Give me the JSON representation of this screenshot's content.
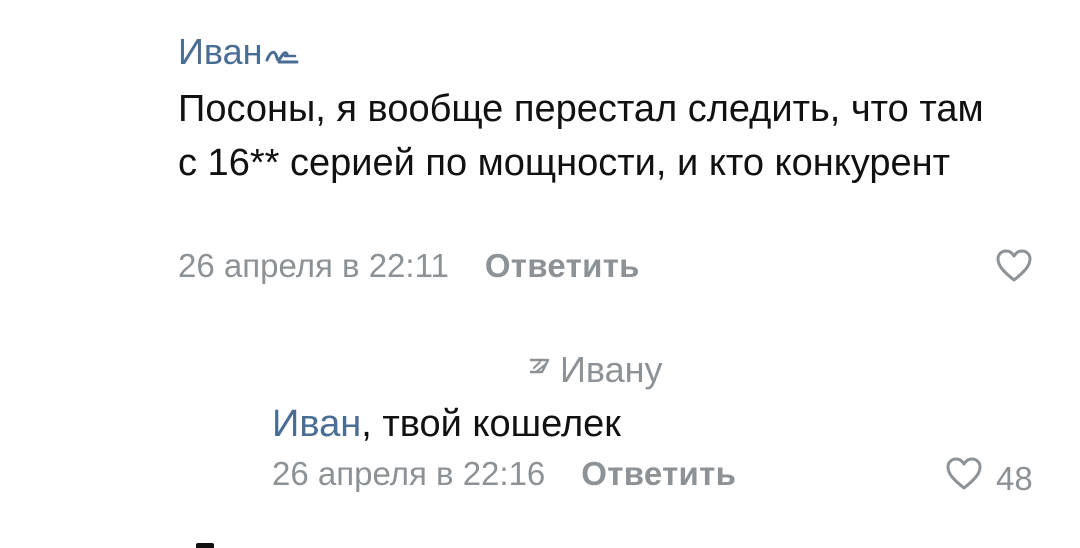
{
  "comment": {
    "author": "Иван",
    "text": "Посоны, я вообще перестал следить, что там с 16** серией по мощности, и кто конкурент",
    "timestamp": "26 апреля в 22:11",
    "reply_label": "Ответить",
    "icons": {
      "like": "heart-outline-icon",
      "author_mark": "scribble-mark-icon"
    }
  },
  "reply": {
    "reply_to": "Ивану",
    "mention": "Иван",
    "text": ", твой кошелек",
    "timestamp": "26 апреля в 22:16",
    "reply_label": "Ответить",
    "like_count": "48",
    "icons": {
      "like": "heart-outline-icon",
      "reply_to": "reply-arrow-icon"
    }
  },
  "colors": {
    "author_link": "#4a6d94",
    "text": "#111111",
    "meta": "#8d9297",
    "background": "#ffffff"
  }
}
